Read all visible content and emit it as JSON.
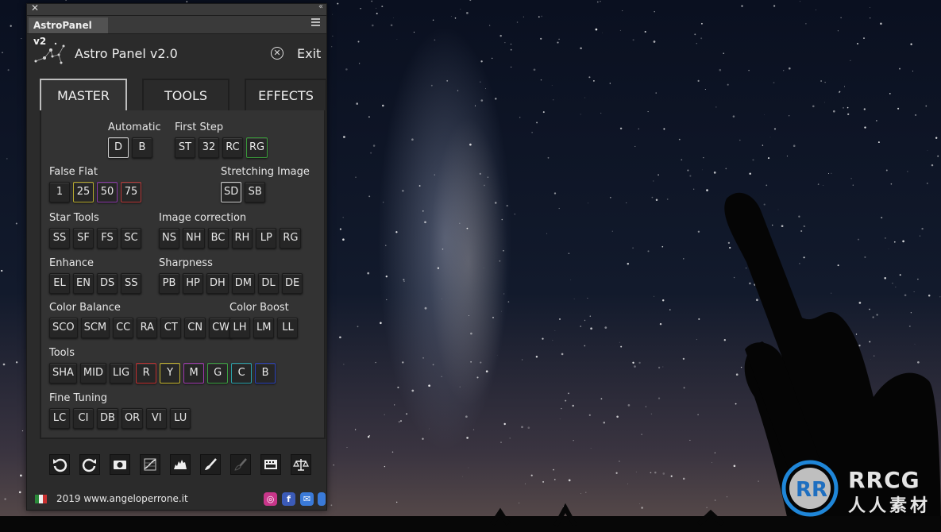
{
  "panel": {
    "window_tab": "AstroPanel v2",
    "title": "Astro Panel v2.0",
    "exit_label": "Exit",
    "tabs": [
      "MASTER",
      "TOOLS",
      "EFFECTS"
    ],
    "active_tab": "MASTER"
  },
  "sections": {
    "automatic": {
      "label": "Automatic",
      "buttons": [
        "D",
        "B"
      ]
    },
    "first_step": {
      "label": "First Step",
      "buttons": [
        "ST",
        "32",
        "RC",
        "RG"
      ]
    },
    "false_flat": {
      "label": "False Flat",
      "buttons": [
        "1",
        "25",
        "50",
        "75"
      ]
    },
    "stretching": {
      "label": "Stretching Image",
      "buttons": [
        "SD",
        "SB"
      ]
    },
    "star_tools": {
      "label": "Star Tools",
      "buttons": [
        "SS",
        "SF",
        "FS",
        "SC"
      ]
    },
    "image_correction": {
      "label": "Image correction",
      "buttons": [
        "NS",
        "NH",
        "BC",
        "RH",
        "LP",
        "RG"
      ]
    },
    "enhance": {
      "label": "Enhance",
      "buttons": [
        "EL",
        "EN",
        "DS",
        "SS"
      ]
    },
    "sharpness": {
      "label": "Sharpness",
      "buttons": [
        "PB",
        "HP",
        "DH",
        "DM",
        "DL",
        "DE"
      ]
    },
    "color_balance": {
      "label": "Color Balance",
      "buttons": [
        "SCO",
        "SCM",
        "CC",
        "RA",
        "CT",
        "CN",
        "CW"
      ]
    },
    "color_boost": {
      "label": "Color Boost",
      "buttons": [
        "LH",
        "LM",
        "LL"
      ]
    },
    "tools": {
      "label": "Tools",
      "buttons": [
        "SHA",
        "MID",
        "LIG",
        "R",
        "Y",
        "M",
        "G",
        "C",
        "B"
      ]
    },
    "fine_tuning": {
      "label": "Fine Tuning",
      "buttons": [
        "LC",
        "CI",
        "DB",
        "OR",
        "VI",
        "LU"
      ]
    }
  },
  "button_accents": {
    "first_step_RG": "#3a9a3a",
    "false_flat_25": "#b5a82e",
    "false_flat_50": "#8a3aa8",
    "false_flat_75": "#b83a3a",
    "tools_R": "#c03030",
    "tools_Y": "#c8b830",
    "tools_M": "#a03ab0",
    "tools_G": "#3aa040",
    "tools_C": "#2aa0a8",
    "tools_B": "#2a40b8",
    "selected": "#cfcfcf"
  },
  "toolbar_icons": [
    "undo-icon",
    "redo-icon",
    "camera-icon",
    "curves-icon",
    "histogram-icon",
    "brush-icon",
    "brush-dark-icon",
    "filmstrip-icon",
    "scales-icon"
  ],
  "footer": {
    "text": "2019 www.angeloperrone.it",
    "social_icons": [
      "instagram-icon",
      "facebook-icon",
      "mail-icon",
      "more-icon"
    ]
  },
  "watermark": {
    "line1": "RRCG",
    "line2": "人人素材"
  }
}
